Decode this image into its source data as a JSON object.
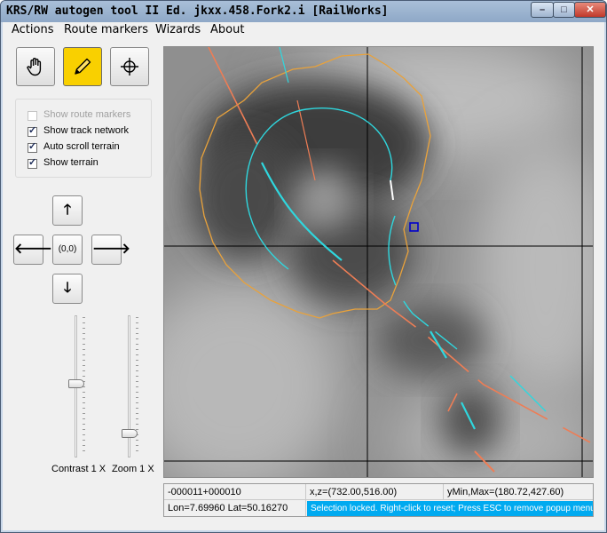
{
  "window": {
    "title": "KRS/RW autogen tool II Ed. jkxx.458.Fork2.i [RailWorks]",
    "min": "–",
    "max": "□",
    "close": "✕"
  },
  "menu": [
    "Actions",
    "Route markers",
    "Wizards",
    "About"
  ],
  "tools": [
    {
      "name": "pan-hand-icon",
      "active": false
    },
    {
      "name": "pencil-icon",
      "active": true
    },
    {
      "name": "crosshair-icon",
      "active": false
    }
  ],
  "options": [
    {
      "label": "Show route markers",
      "checked": false,
      "enabled": false
    },
    {
      "label": "Show track network",
      "checked": true,
      "enabled": true
    },
    {
      "label": "Auto scroll terrain",
      "checked": true,
      "enabled": true
    },
    {
      "label": "Show terrain",
      "checked": true,
      "enabled": true
    }
  ],
  "nav": {
    "up": "🡑",
    "down": "🡓",
    "left": "🡐",
    "right": "🡒",
    "center": "(0,0)"
  },
  "sliders": {
    "contrast": {
      "label": "Contrast 1 X",
      "level": 0.48
    },
    "zoom": {
      "label": "Zoom 1 X",
      "level": 0.85
    }
  },
  "status": {
    "tile": "-000011+000010",
    "xz": "x,z=(732.00,516.00)",
    "ymin": "yMin,Max=(180.72,427.60)",
    "lonlat": "Lon=7.69960 Lat=50.16270",
    "message": "Selection locked. Right-click to reset; Press ESC to remove popup menu"
  },
  "colors": {
    "active_tool": "#f9d000",
    "track_cyan": "#2fd7de",
    "track_orange": "#ee7d55",
    "boundary": "#e9a23b",
    "selection": "#0000cc",
    "status_msg": "#00aaf0"
  }
}
